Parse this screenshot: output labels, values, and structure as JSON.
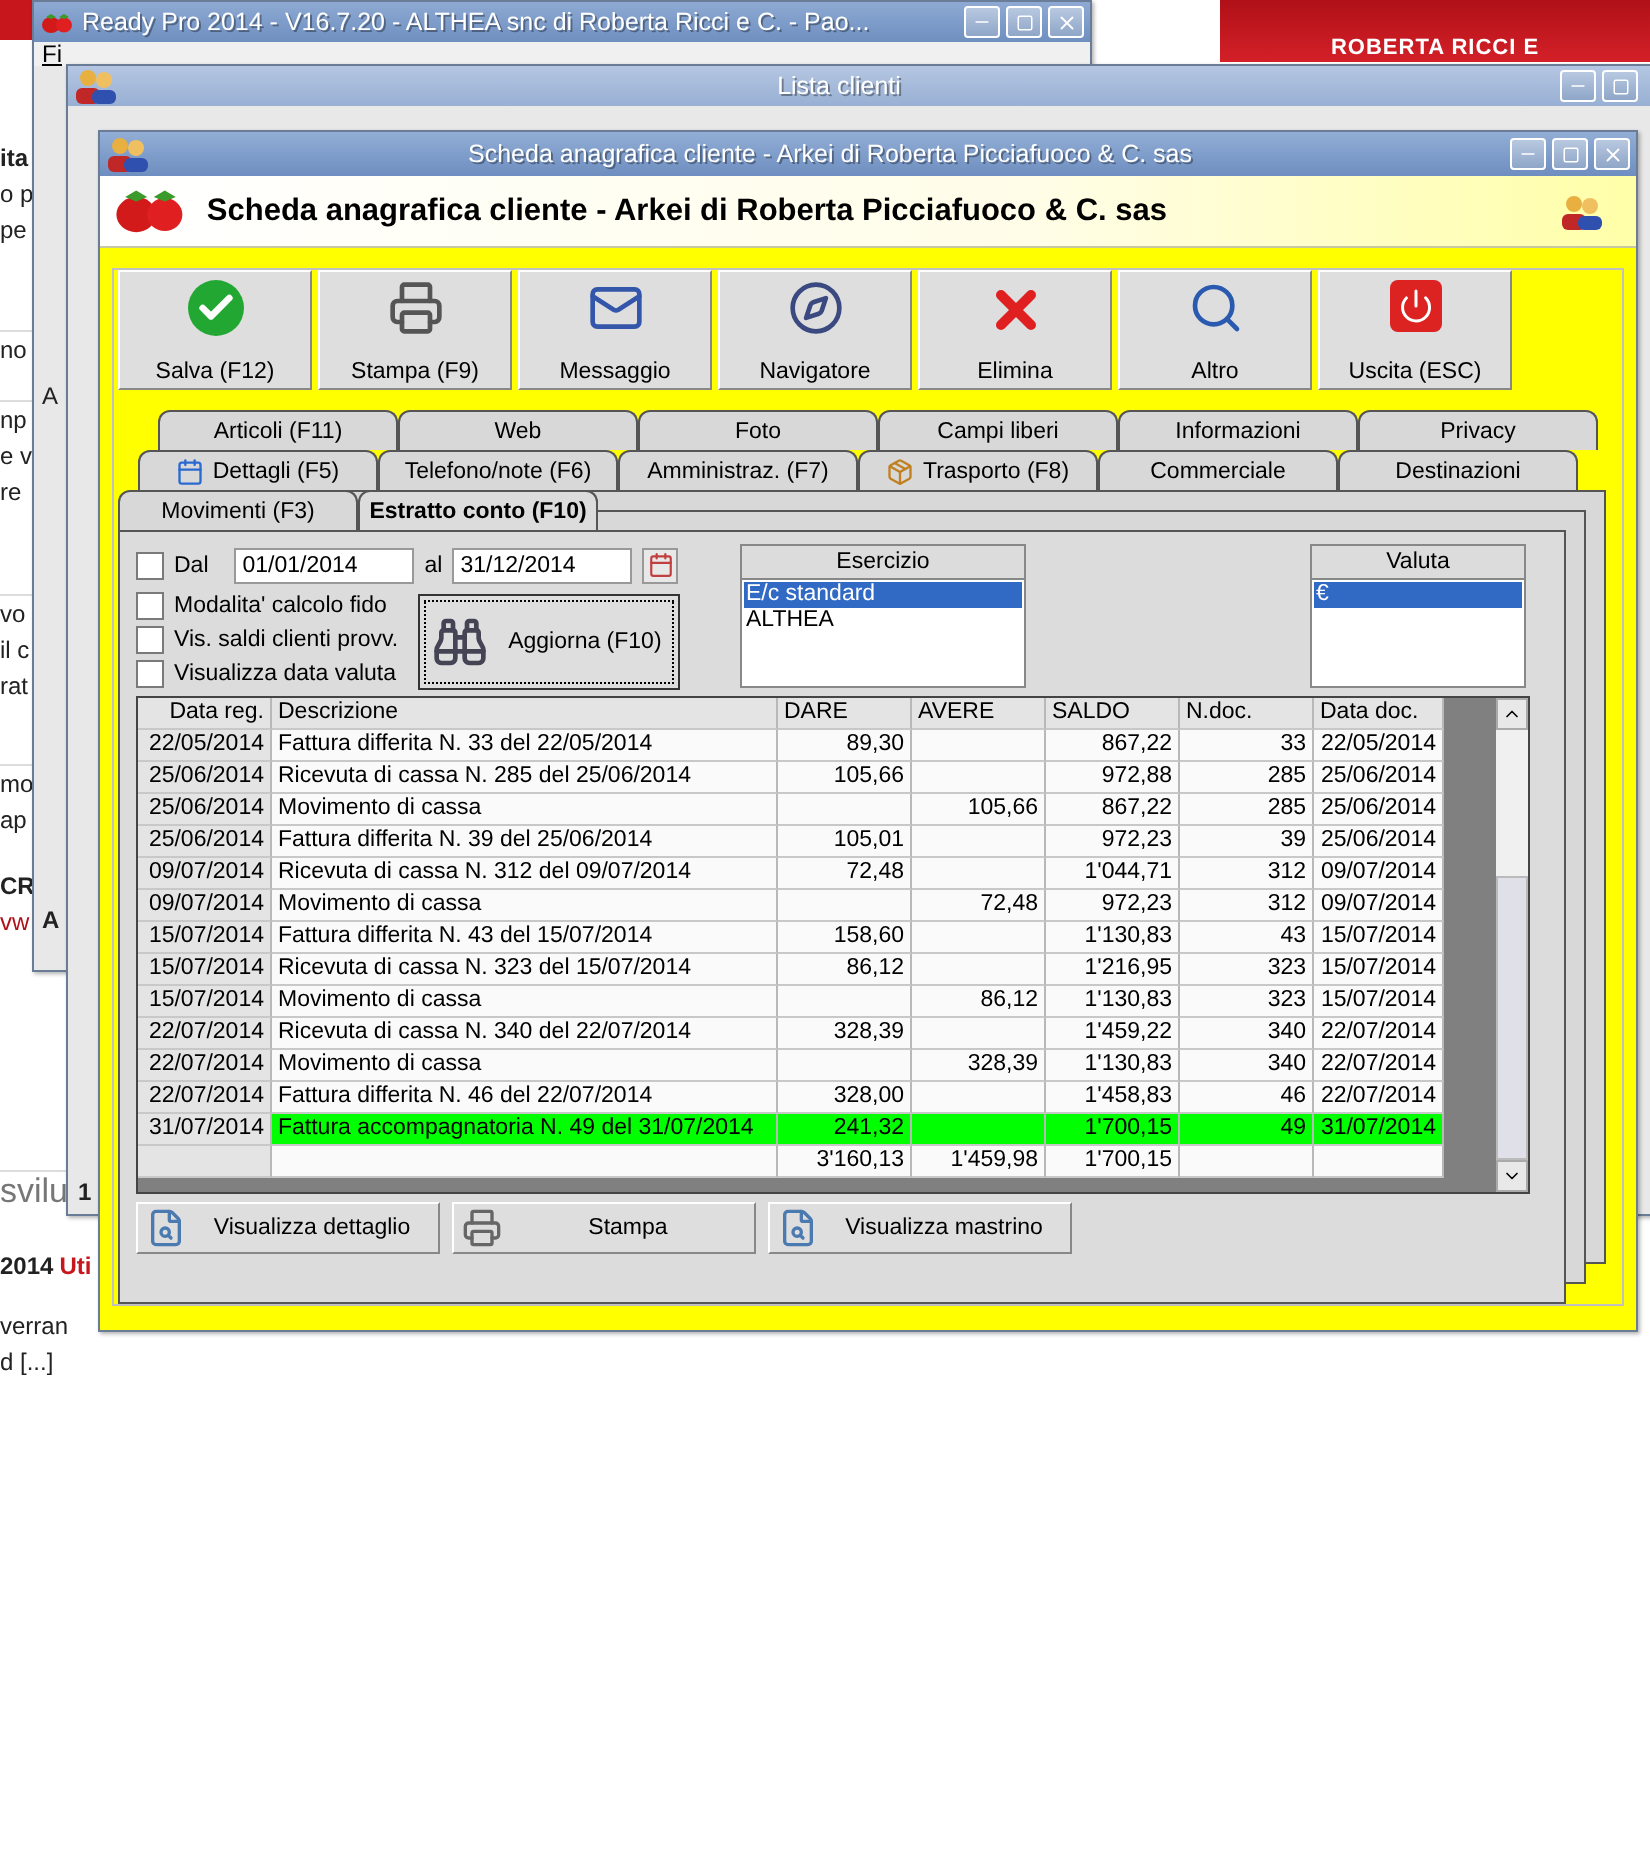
{
  "background_page": {
    "header_text": "ROBERTA RICCI E",
    "groups": [
      {
        "lines": [
          {
            "text": "ita",
            "kind": "bold"
          },
          {
            "text": "o p",
            "kind": "plain"
          },
          {
            "text": "pe",
            "kind": "plain"
          }
        ]
      },
      {
        "lines": [
          {
            "text": "no",
            "kind": "plain"
          }
        ]
      },
      {
        "lines": [
          {
            "text": "np",
            "kind": "plain"
          },
          {
            "text": "e v",
            "kind": "plain"
          },
          {
            "text": "re",
            "kind": "plain"
          }
        ]
      },
      {
        "lines": [
          {
            "text": "vo",
            "kind": "plain"
          },
          {
            "text": "il c",
            "kind": "plain"
          },
          {
            "text": "rat",
            "kind": "plain"
          }
        ]
      },
      {
        "lines": [
          {
            "text": "mo",
            "kind": "plain"
          },
          {
            "text": "ap",
            "kind": "plain"
          }
        ]
      },
      {
        "lines": [
          {
            "text": "CR",
            "kind": "bold"
          },
          {
            "text": "vw",
            "kind": "link"
          }
        ]
      },
      {
        "lines": [
          {
            "text": "svilu",
            "kind": "big"
          }
        ]
      },
      {
        "lines": [
          {
            "text": "2014",
            "kind": "bold"
          },
          {
            "text": "Uti",
            "kind": "redbold"
          }
        ]
      },
      {
        "lines": [
          {
            "text": "verran",
            "kind": "plain"
          },
          {
            "text": "d [...]",
            "kind": "plain"
          }
        ]
      }
    ]
  },
  "main_window": {
    "title": "Ready Pro 2014 - V16.7.20 - ALTHEA snc di Roberta Ricci e C. - Pao...",
    "menu": "Fi",
    "fragments": [
      "A",
      "A"
    ]
  },
  "list_window": {
    "title": "Lista clienti",
    "fragment": "1"
  },
  "card_window": {
    "title": "Scheda anagrafica cliente - Arkei di Roberta Picciafuoco & C. sas",
    "heading": "Scheda anagrafica cliente - Arkei di Roberta Picciafuoco & C. sas",
    "toolbar": [
      {
        "label": "Salva (F12)"
      },
      {
        "label": "Stampa (F9)"
      },
      {
        "label": "Messaggio"
      },
      {
        "label": "Navigatore"
      },
      {
        "label": "Elimina"
      },
      {
        "label": "Altro"
      },
      {
        "label": "Uscita (ESC)"
      }
    ],
    "tab_rows": [
      [
        {
          "label": "Articoli (F11)",
          "selected": false
        },
        {
          "label": "Web",
          "selected": false
        },
        {
          "label": "Foto",
          "selected": false
        },
        {
          "label": "Campi liberi",
          "selected": false
        },
        {
          "label": "Informazioni",
          "selected": false
        },
        {
          "label": "Privacy",
          "selected": false
        }
      ],
      [
        {
          "label": "Dettagli (F5)",
          "selected": false
        },
        {
          "label": "Telefono/note (F6)",
          "selected": false
        },
        {
          "label": "Amministraz. (F7)",
          "selected": false
        },
        {
          "label": "Trasporto (F8)",
          "selected": false
        },
        {
          "label": "Commerciale",
          "selected": false
        },
        {
          "label": "Destinazioni",
          "selected": false
        }
      ],
      [
        {
          "label": "Movimenti (F3)",
          "selected": false
        },
        {
          "label": "Estratto conto (F10)",
          "selected": true
        }
      ]
    ],
    "filters": {
      "from_check": {
        "label": "Dal",
        "checked": false
      },
      "from": "01/01/2014",
      "to_label": "al",
      "to": "31/12/2014",
      "options": [
        {
          "label": "Modalita' calcolo fido",
          "checked": false
        },
        {
          "label": "Vis. saldi clienti provv.",
          "checked": false
        },
        {
          "label": "Visualizza data valuta",
          "checked": false
        }
      ],
      "refresh": "Aggiorna (F10)"
    },
    "esercizio": {
      "header": "Esercizio",
      "items": [
        {
          "label": "E/c standard",
          "selected": true
        },
        {
          "label": "ALTHEA",
          "selected": false
        }
      ]
    },
    "valuta": {
      "header": "Valuta",
      "items": [
        {
          "label": "€",
          "selected": true
        }
      ]
    },
    "table": {
      "columns": [
        "Data reg.",
        "Descrizione",
        "DARE",
        "AVERE",
        "SALDO",
        "N.doc.",
        "Data doc."
      ],
      "rows": [
        {
          "cells": [
            "22/05/2014",
            "Fattura differita N. 33 del 22/05/2014",
            "89,30",
            "",
            "867,22",
            "33",
            "22/05/2014"
          ],
          "selected": false
        },
        {
          "cells": [
            "25/06/2014",
            "Ricevuta di cassa N. 285 del 25/06/2014",
            "105,66",
            "",
            "972,88",
            "285",
            "25/06/2014"
          ],
          "selected": false
        },
        {
          "cells": [
            "25/06/2014",
            "Movimento di cassa",
            "",
            "105,66",
            "867,22",
            "285",
            "25/06/2014"
          ],
          "selected": false
        },
        {
          "cells": [
            "25/06/2014",
            "Fattura differita N. 39 del 25/06/2014",
            "105,01",
            "",
            "972,23",
            "39",
            "25/06/2014"
          ],
          "selected": false
        },
        {
          "cells": [
            "09/07/2014",
            "Ricevuta di cassa N. 312 del 09/07/2014",
            "72,48",
            "",
            "1'044,71",
            "312",
            "09/07/2014"
          ],
          "selected": false
        },
        {
          "cells": [
            "09/07/2014",
            "Movimento di cassa",
            "",
            "72,48",
            "972,23",
            "312",
            "09/07/2014"
          ],
          "selected": false
        },
        {
          "cells": [
            "15/07/2014",
            "Fattura differita N. 43 del 15/07/2014",
            "158,60",
            "",
            "1'130,83",
            "43",
            "15/07/2014"
          ],
          "selected": false
        },
        {
          "cells": [
            "15/07/2014",
            "Ricevuta di cassa N. 323 del 15/07/2014",
            "86,12",
            "",
            "1'216,95",
            "323",
            "15/07/2014"
          ],
          "selected": false
        },
        {
          "cells": [
            "15/07/2014",
            "Movimento di cassa",
            "",
            "86,12",
            "1'130,83",
            "323",
            "15/07/2014"
          ],
          "selected": false
        },
        {
          "cells": [
            "22/07/2014",
            "Ricevuta di cassa N. 340 del 22/07/2014",
            "328,39",
            "",
            "1'459,22",
            "340",
            "22/07/2014"
          ],
          "selected": false
        },
        {
          "cells": [
            "22/07/2014",
            "Movimento di cassa",
            "",
            "328,39",
            "1'130,83",
            "340",
            "22/07/2014"
          ],
          "selected": false
        },
        {
          "cells": [
            "22/07/2014",
            "Fattura differita N. 46 del 22/07/2014",
            "328,00",
            "",
            "1'458,83",
            "46",
            "22/07/2014"
          ],
          "selected": false
        },
        {
          "cells": [
            "31/07/2014",
            "Fattura accompagnatoria N. 49 del 31/07/2014",
            "241,32",
            "",
            "1'700,15",
            "49",
            "31/07/2014"
          ],
          "selected": true
        }
      ],
      "totals": {
        "dare": "3'160,13",
        "avere": "1'459,98",
        "saldo": "1'700,15"
      }
    },
    "actions": [
      {
        "label": "Visualizza dettaglio"
      },
      {
        "label": "Stampa"
      },
      {
        "label": "Visualizza mastrino"
      }
    ]
  }
}
